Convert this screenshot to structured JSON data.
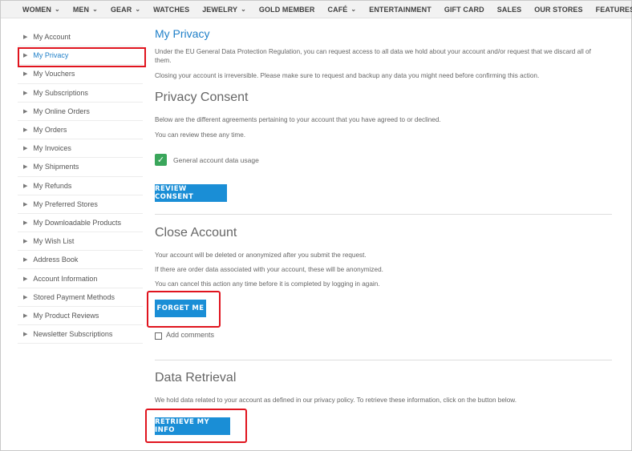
{
  "nav": {
    "items": [
      {
        "label": "WOMEN",
        "chevron": true
      },
      {
        "label": "MEN",
        "chevron": true
      },
      {
        "label": "GEAR",
        "chevron": true
      },
      {
        "label": "WATCHES",
        "chevron": false
      },
      {
        "label": "JEWELRY",
        "chevron": true
      },
      {
        "label": "GOLD MEMBER",
        "chevron": false
      },
      {
        "label": "CAFÉ",
        "chevron": true
      },
      {
        "label": "ENTERTAINMENT",
        "chevron": false
      },
      {
        "label": "GIFT CARD",
        "chevron": false
      },
      {
        "label": "SALES",
        "chevron": false
      },
      {
        "label": "OUR STORES",
        "chevron": false
      },
      {
        "label": "FEATURES",
        "chevron": false
      }
    ]
  },
  "sidebar": {
    "items": [
      {
        "label": "My Account"
      },
      {
        "label": "My Privacy",
        "active": true
      },
      {
        "label": "My Vouchers"
      },
      {
        "label": "My Subscriptions"
      },
      {
        "label": "My Online Orders"
      },
      {
        "label": "My Orders"
      },
      {
        "label": "My Invoices"
      },
      {
        "label": "My Shipments"
      },
      {
        "label": "My Refunds"
      },
      {
        "label": "My Preferred Stores"
      },
      {
        "label": "My Downloadable Products"
      },
      {
        "label": "My Wish List"
      },
      {
        "label": "Address Book"
      },
      {
        "label": "Account Information"
      },
      {
        "label": "Stored Payment Methods"
      },
      {
        "label": "My Product Reviews"
      },
      {
        "label": "Newsletter Subscriptions"
      }
    ]
  },
  "main": {
    "title": "My Privacy",
    "intro1": "Under the EU General Data Protection Regulation, you can request access to all data we hold about your account and/or request that we discard all of them.",
    "intro2": "Closing your account is irreversible. Please make sure to request and backup any data you might need before confirming this action.",
    "consent": {
      "heading": "Privacy Consent",
      "text1": "Below are the different agreements pertaining to your account that you have agreed to or declined.",
      "text2": "You can review these any time.",
      "checkbox_label": "General account data usage",
      "button": "REVIEW CONSENT"
    },
    "close": {
      "heading": "Close Account",
      "text1": "Your account will be deleted or anonymized after you submit the request.",
      "text2": "If there are order data associated with your account, these will be anonymized.",
      "text3": "You can cancel this action any time before it is completed by logging in again.",
      "button": "FORGET ME",
      "comments_label": "Add comments"
    },
    "retrieval": {
      "heading": "Data Retrieval",
      "text1": "We hold data related to your account as defined in our privacy policy. To retrieve these information, click on the button below.",
      "button": "RETRIEVE MY INFO"
    }
  },
  "icons": {
    "nav_chevron": "chevron-down-icon",
    "sidebar_arrow": "caret-right-icon",
    "check": "checkmark-icon"
  },
  "colors": {
    "accent": "#1e7fc8",
    "button": "#1a8ed6",
    "highlight": "#e0141e",
    "check_green": "#3aa65b"
  }
}
